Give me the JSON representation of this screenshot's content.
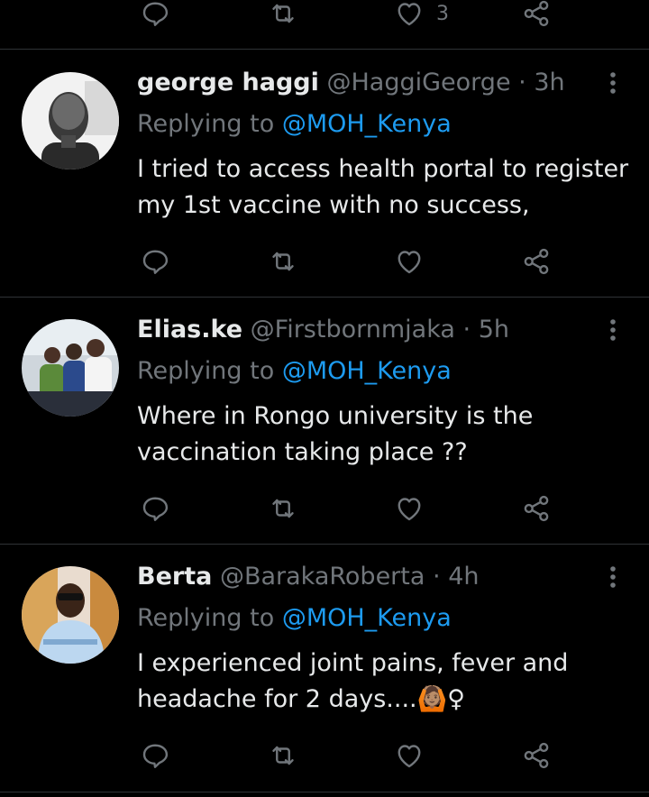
{
  "top_actions": {
    "like_count": "3"
  },
  "tweets": [
    {
      "name": "george haggi",
      "handle": "@HaggiGeorge",
      "separator": "·",
      "time": "3h",
      "replying_prefix": "Replying to",
      "replying_to": "@MOH_Kenya",
      "text_lines": [
        "I tried to access health portal to register",
        "my 1st vaccine with no success,"
      ]
    },
    {
      "name": "Elias.ke",
      "handle": "@Firstbornmjaka",
      "separator": "·",
      "time": "5h",
      "replying_prefix": "Replying to",
      "replying_to": "@MOH_Kenya",
      "text_lines": [
        "Where in Rongo university is the",
        "vaccination taking place ??"
      ]
    },
    {
      "name": "Berta",
      "handle": "@BarakaRoberta",
      "separator": "·",
      "time": "4h",
      "replying_prefix": "Replying to",
      "replying_to": "@MOH_Kenya",
      "text_lines": [
        "I experienced joint pains, fever and",
        "headache for 2 days....🙆🏽♀"
      ]
    }
  ],
  "icons": [
    "reply-icon",
    "retweet-icon",
    "like-icon",
    "share-icon",
    "more-icon"
  ],
  "colors": {
    "background": "#000000",
    "text": "#e7e9ea",
    "muted": "#71767b",
    "link": "#1d9bf0",
    "divider": "#2f3336"
  }
}
